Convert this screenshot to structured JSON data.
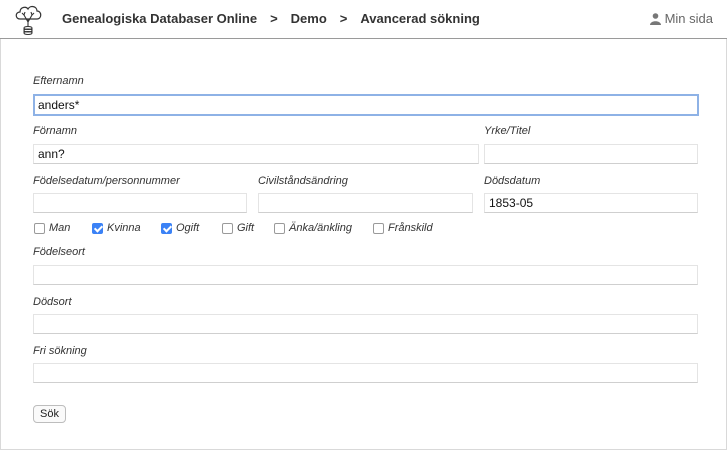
{
  "header": {
    "breadcrumb": [
      "Genealogiska Databaser Online",
      "Demo",
      "Avancerad sökning"
    ],
    "separator": ">",
    "my_page_label": "Min sida"
  },
  "form": {
    "surname": {
      "label": "Efternamn",
      "value": "anders*"
    },
    "firstname": {
      "label": "Förnamn",
      "value": "ann?"
    },
    "occupation": {
      "label": "Yrke/Titel",
      "value": ""
    },
    "birth_date": {
      "label": "Födelsedatum/personnummer",
      "value": ""
    },
    "civil_change": {
      "label": "Civilståndsändring",
      "value": ""
    },
    "death_date": {
      "label": "Dödsdatum",
      "value": "1853-05"
    },
    "checkboxes": [
      {
        "label": "Man",
        "checked": false
      },
      {
        "label": "Kvinna",
        "checked": true
      },
      {
        "label": "Ogift",
        "checked": true
      },
      {
        "label": "Gift",
        "checked": false
      },
      {
        "label": "Änka/änkling",
        "checked": false
      },
      {
        "label": "Frånskild",
        "checked": false
      }
    ],
    "birth_place": {
      "label": "Födelseort",
      "value": ""
    },
    "death_place": {
      "label": "Dödsort",
      "value": ""
    },
    "free_search": {
      "label": "Fri sökning",
      "value": ""
    },
    "submit_label": "Sök"
  },
  "colors": {
    "focus": "#8eb2e6",
    "checkbox_checked": "#3b82f6"
  }
}
